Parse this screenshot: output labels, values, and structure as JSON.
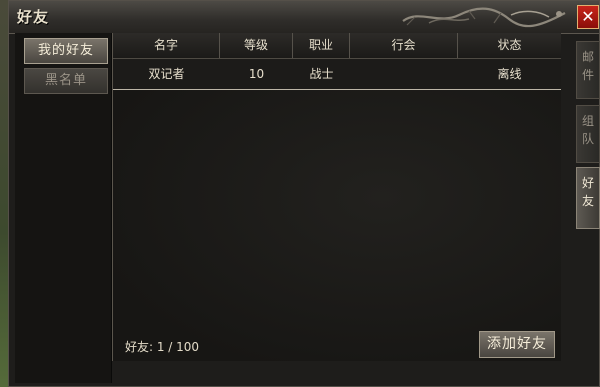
{
  "window": {
    "title": "好友",
    "close_label": "✕"
  },
  "left_tabs": {
    "my_friends": "我的好友",
    "blacklist": "黑名单"
  },
  "table": {
    "columns": [
      "名字",
      "等级",
      "职业",
      "行会",
      "状态"
    ],
    "rows": [
      {
        "name": "双记者",
        "level": "10",
        "class": "战士",
        "guild": "",
        "status": "离线"
      }
    ]
  },
  "footer": {
    "count_text": "好友: 1 / 100",
    "add_button": "添加好友"
  },
  "right_tabs": [
    {
      "c1": "邮",
      "c2": "件"
    },
    {
      "c1": "组",
      "c2": "队"
    },
    {
      "c1": "好",
      "c2": "友"
    }
  ],
  "colors": {
    "close_red": "#b0180f",
    "text_light": "#e8e0cd"
  }
}
